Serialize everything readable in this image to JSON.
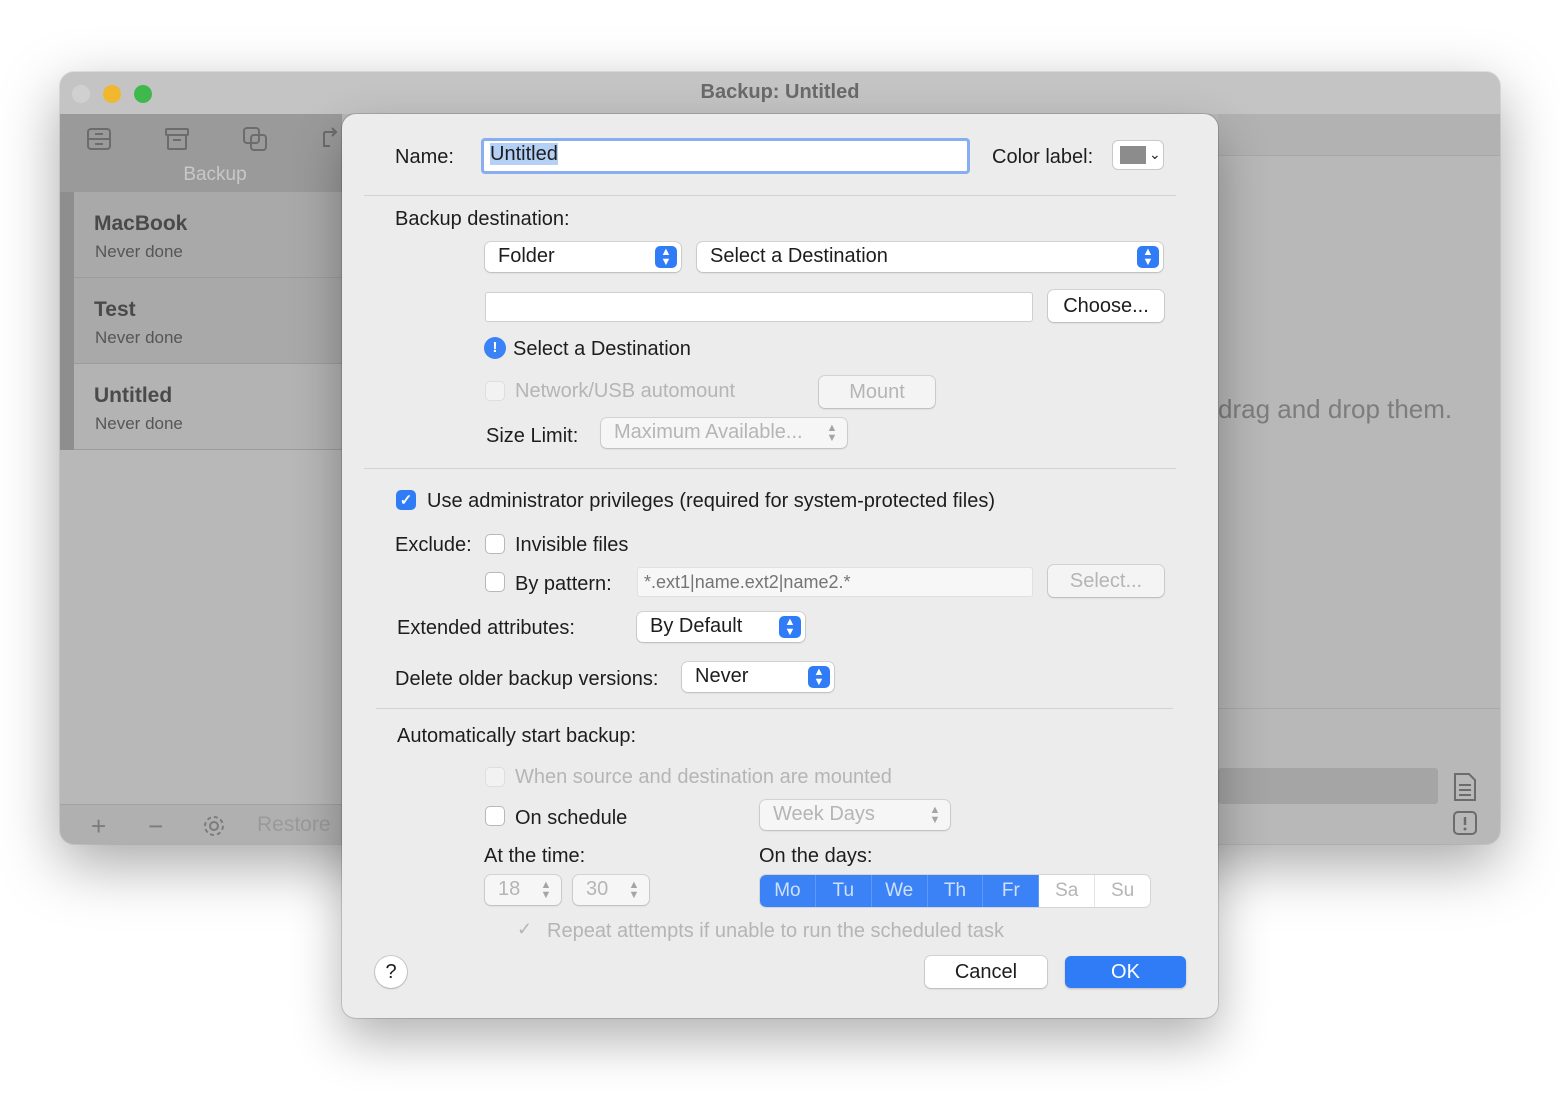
{
  "window": {
    "title": "Backup: Untitled",
    "tab_label": "Backup",
    "backups": [
      {
        "name": "MacBook",
        "status": "Never done"
      },
      {
        "name": "Test",
        "status": "Never done"
      },
      {
        "name": "Untitled",
        "status": "Never done"
      }
    ],
    "restore_label": "Restore",
    "drag_hint": "drag and drop them."
  },
  "sheet": {
    "name_label": "Name:",
    "name_value": "Untitled",
    "color_label": "Color label:",
    "color_value": "#8c8c8c",
    "backup_destination_label": "Backup destination:",
    "destination_type": "Folder",
    "destination_select": "Select a Destination",
    "path_value": "",
    "choose_button": "Choose...",
    "warning_text": "Select a Destination",
    "network_automount_label": "Network/USB automount",
    "mount_button": "Mount",
    "size_limit_label": "Size Limit:",
    "size_limit_value": "Maximum Available...",
    "admin_privileges_label": "Use administrator privileges (required for system-protected files)",
    "admin_privileges_checked": true,
    "exclude_label": "Exclude:",
    "invisible_files_label": "Invisible files",
    "by_pattern_label": "By pattern:",
    "pattern_placeholder": "*.ext1|name.ext2|name2.*",
    "select_button": "Select...",
    "extended_attributes_label": "Extended attributes:",
    "extended_attributes_value": "By Default",
    "delete_older_label": "Delete older backup versions:",
    "delete_older_value": "Never",
    "auto_start_label": "Automatically start backup:",
    "when_mounted_label": "When source and destination are mounted",
    "on_schedule_label": "On schedule",
    "schedule_value": "Week Days",
    "at_time_label": "At the time:",
    "hour_value": "18",
    "minute_value": "30",
    "on_days_label": "On the days:",
    "days": [
      {
        "label": "Mo",
        "selected": true
      },
      {
        "label": "Tu",
        "selected": true
      },
      {
        "label": "We",
        "selected": true
      },
      {
        "label": "Th",
        "selected": true
      },
      {
        "label": "Fr",
        "selected": true
      },
      {
        "label": "Sa",
        "selected": false
      },
      {
        "label": "Su",
        "selected": false
      }
    ],
    "repeat_label": "Repeat attempts if unable to run the scheduled task",
    "help_label": "?",
    "cancel_button": "Cancel",
    "ok_button": "OK"
  },
  "colors": {
    "accent": "#2f7cf6",
    "focus_ring": "#86aef0",
    "sheet_bg": "#ececec"
  },
  "icons": [
    "backup-tab-icon",
    "archive-tab-icon",
    "copy-tab-icon",
    "sync-tab-icon",
    "info-icon",
    "stepper-icon",
    "checkmark-icon",
    "add-icon",
    "remove-icon",
    "gear-icon",
    "log-icon",
    "alert-icon",
    "help-icon"
  ]
}
